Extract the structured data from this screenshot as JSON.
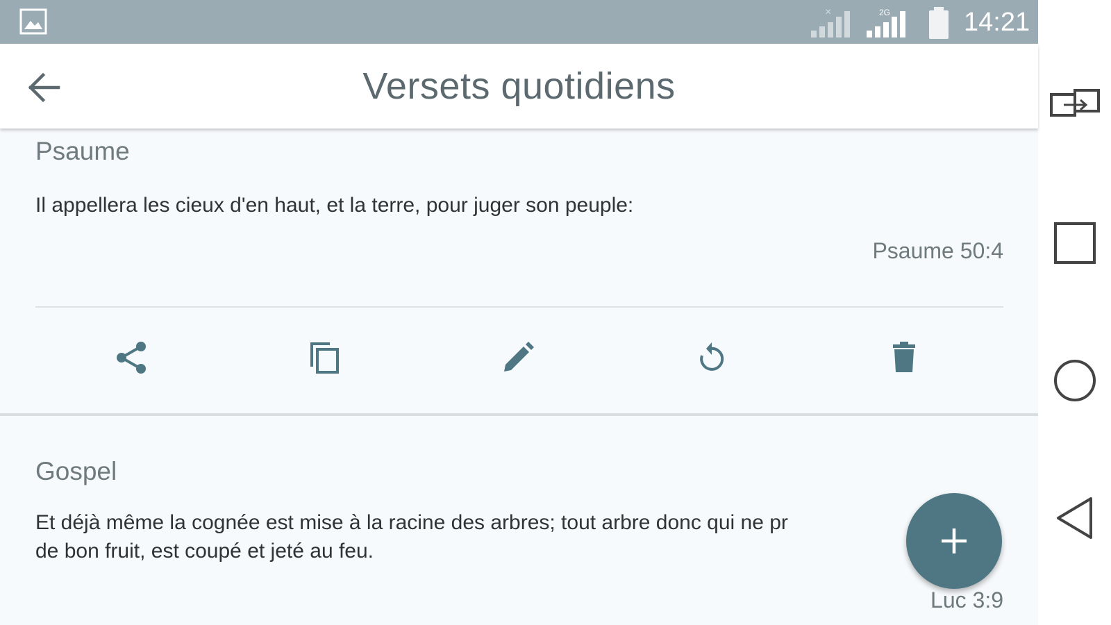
{
  "status_bar": {
    "time": "14:21",
    "icons": [
      "gallery-icon",
      "signal-icon",
      "network-2g-signal-icon",
      "battery-icon"
    ]
  },
  "app_bar": {
    "title": "Versets quotidiens",
    "back_icon": "arrow-back-icon"
  },
  "verses": [
    {
      "category": "Psaume",
      "text": "Il appellera les cieux d'en haut, et la terre, pour juger son peuple:",
      "reference": "Psaume 50:4",
      "actions": [
        "share-icon",
        "copy-icon",
        "edit-icon",
        "refresh-icon",
        "delete-icon"
      ]
    },
    {
      "category": "Gospel",
      "text_line1": "Et déjà même la cognée est mise à la racine des arbres; tout arbre donc qui ne pr",
      "text_line2": "de bon fruit, est coupé et jeté au feu.",
      "reference": "Luc 3:9"
    }
  ],
  "fab": {
    "icon": "plus-icon"
  },
  "nav_bar": {
    "icons": [
      "dual-window-icon",
      "recents-icon",
      "home-icon",
      "back-icon"
    ]
  },
  "colors": {
    "status_bar": "#9aabb3",
    "accent": "#4f7783",
    "icon": "#4f7783",
    "card_bg": "#f7fafc"
  }
}
